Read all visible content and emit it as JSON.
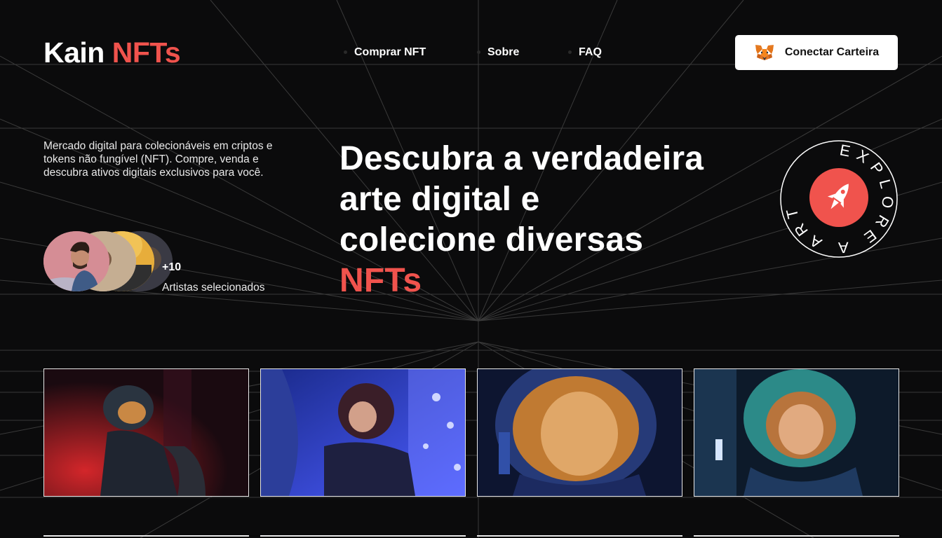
{
  "header": {
    "logo_main": "Kain",
    "logo_accent": "NFTs",
    "nav": [
      "Comprar NFT",
      "Sobre",
      "FAQ"
    ],
    "wallet_button": "Conectar Carteira"
  },
  "hero": {
    "intro": "Mercado digital para colecionáveis em criptos e tokens não fungível (NFT). Compre, venda e descubra ativos digitais exclusivos para você.",
    "artists_count": "+10",
    "artists_label": "Artistas selecionados",
    "headline_lines": [
      "Descubra a verdadeira",
      "arte digital e",
      "colecione diversas"
    ],
    "headline_accent": "NFTs",
    "badge_text": "EXPLORE A ARTE"
  },
  "colors": {
    "accent": "#f0534d",
    "background": "#0b0b0c",
    "button_bg": "#ffffff"
  },
  "icons": {
    "wallet": "metamask-fox-icon",
    "badge_center": "rocket-icon"
  },
  "gallery": {
    "items": [
      "astronaut-red",
      "astronaut-blue",
      "astronaut-helmet-gold",
      "astronaut-helmet-teal"
    ]
  }
}
